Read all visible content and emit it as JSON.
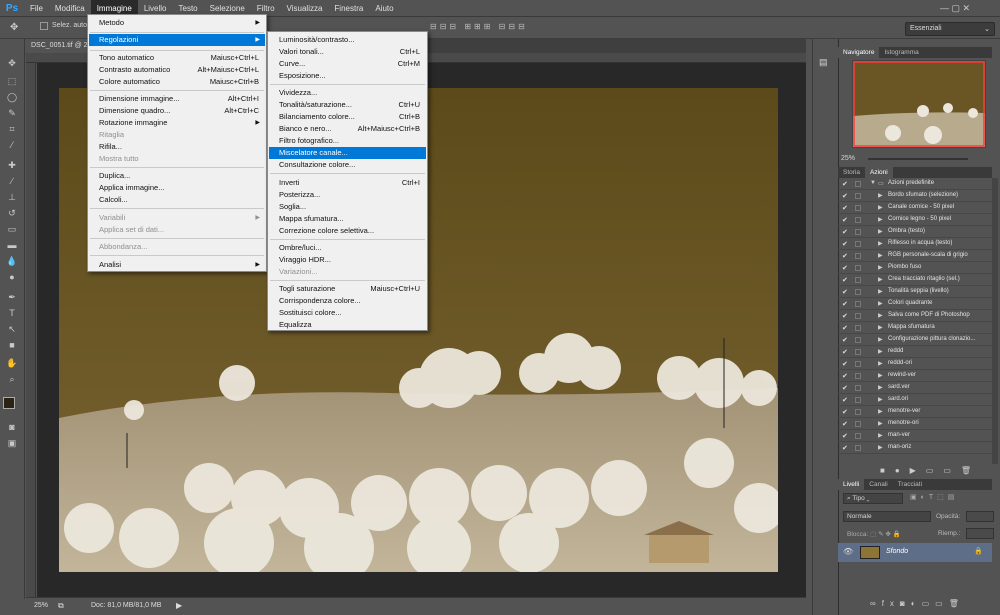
{
  "app": {
    "logo": "Ps"
  },
  "menubar": [
    "File",
    "Modifica",
    "Immagine",
    "Livello",
    "Testo",
    "Selezione",
    "Filtro",
    "Visualizza",
    "Finestra",
    "Aiuto"
  ],
  "options": {
    "select_label": "Selez. auto",
    "workspace": "Essenziali"
  },
  "document": {
    "tab": "DSC_0051.tif @ 2",
    "zoom": "25%",
    "doc_info": "Doc: 81,0 MB/81,0 MB"
  },
  "immagine_menu": [
    {
      "label": "Metodo",
      "shortcut": "",
      "submenu": true,
      "disabled": false
    },
    {
      "label": "Regolazioni",
      "shortcut": "",
      "submenu": true,
      "disabled": false,
      "highlight": true
    },
    {
      "label": "Tono automatico",
      "shortcut": "Maiusc+Ctrl+L",
      "disabled": false
    },
    {
      "label": "Contrasto automatico",
      "shortcut": "Alt+Maiusc+Ctrl+L",
      "disabled": false
    },
    {
      "label": "Colore automatico",
      "shortcut": "Maiusc+Ctrl+B",
      "disabled": false
    },
    {
      "label": "Dimensione immagine...",
      "shortcut": "Alt+Ctrl+I",
      "disabled": false
    },
    {
      "label": "Dimensione quadro...",
      "shortcut": "Alt+Ctrl+C",
      "disabled": false
    },
    {
      "label": "Rotazione immagine",
      "shortcut": "",
      "submenu": true,
      "disabled": false
    },
    {
      "label": "Ritaglia",
      "shortcut": "",
      "disabled": true
    },
    {
      "label": "Rifila...",
      "shortcut": "",
      "disabled": false
    },
    {
      "label": "Mostra tutto",
      "shortcut": "",
      "disabled": true
    },
    {
      "label": "Duplica...",
      "shortcut": "",
      "disabled": false
    },
    {
      "label": "Applica immagine...",
      "shortcut": "",
      "disabled": false
    },
    {
      "label": "Calcoli...",
      "shortcut": "",
      "disabled": false
    },
    {
      "label": "Variabili",
      "shortcut": "",
      "submenu": true,
      "disabled": true
    },
    {
      "label": "Applica set di dati...",
      "shortcut": "",
      "disabled": true
    },
    {
      "label": "Abbondanza...",
      "shortcut": "",
      "disabled": true
    },
    {
      "label": "Analisi",
      "shortcut": "",
      "submenu": true,
      "disabled": false
    }
  ],
  "regolazioni_menu": [
    {
      "label": "Luminosità/contrasto...",
      "shortcut": ""
    },
    {
      "label": "Valori tonali...",
      "shortcut": "Ctrl+L"
    },
    {
      "label": "Curve...",
      "shortcut": "Ctrl+M"
    },
    {
      "label": "Esposizione...",
      "shortcut": ""
    },
    {
      "label": "Vividezza...",
      "shortcut": ""
    },
    {
      "label": "Tonalità/saturazione...",
      "shortcut": "Ctrl+U"
    },
    {
      "label": "Bilanciamento colore...",
      "shortcut": "Ctrl+B"
    },
    {
      "label": "Bianco e nero...",
      "shortcut": "Alt+Maiusc+Ctrl+B"
    },
    {
      "label": "Filtro fotografico...",
      "shortcut": ""
    },
    {
      "label": "Miscelatore canale...",
      "shortcut": "",
      "highlight": true
    },
    {
      "label": "Consultazione colore...",
      "shortcut": ""
    },
    {
      "label": "Inverti",
      "shortcut": "Ctrl+I"
    },
    {
      "label": "Posterizza...",
      "shortcut": ""
    },
    {
      "label": "Soglia...",
      "shortcut": ""
    },
    {
      "label": "Mappa sfumatura...",
      "shortcut": ""
    },
    {
      "label": "Correzione colore selettiva...",
      "shortcut": ""
    },
    {
      "label": "Ombre/luci...",
      "shortcut": ""
    },
    {
      "label": "Viraggio HDR...",
      "shortcut": ""
    },
    {
      "label": "Variazioni...",
      "shortcut": "",
      "disabled": true
    },
    {
      "label": "Togli saturazione",
      "shortcut": "Maiusc+Ctrl+U"
    },
    {
      "label": "Corrispondenza colore...",
      "shortcut": ""
    },
    {
      "label": "Sostituisci colore...",
      "shortcut": ""
    },
    {
      "label": "Equalizza",
      "shortcut": ""
    }
  ],
  "navigator": {
    "tabs": [
      "Navigatore",
      "Istogramma"
    ],
    "zoom": "25%"
  },
  "actions": {
    "tabs": [
      "Storia",
      "Azioni"
    ],
    "items": [
      "Azioni predefinite",
      "Bordo sfumato (selezione)",
      "Canale cornice - 50 pixel",
      "Cornice legno - 50 pixel",
      "Ombra (testo)",
      "Riflesso in acqua (testo)",
      "RGB personale-scala di grigio",
      "Piombo fuso",
      "Crea tracciato ritaglio (sel.)",
      "Tonalità seppia (livello)",
      "Colori quadrante",
      "Salva come PDF di Photoshop",
      "Mappa sfumatura",
      "Configurazione pittura clonazio...",
      "reddd",
      "reddd-ori",
      "rewind-ver",
      "sard.ver",
      "sard.ori",
      "menotre-ver",
      "menotre-ori",
      "man-ver",
      "man-oriz"
    ]
  },
  "layers": {
    "tabs": [
      "Livelli",
      "Canali",
      "Tracciati"
    ],
    "filter": "Tipo",
    "blend": "Normale",
    "opacity_label": "Opacità:",
    "fill_label": "Riemp.:",
    "layer_name": "Sfondo"
  },
  "colors": {
    "accent": "#0078d7",
    "panel": "#535353",
    "photo_sky": "#6e5a22"
  }
}
